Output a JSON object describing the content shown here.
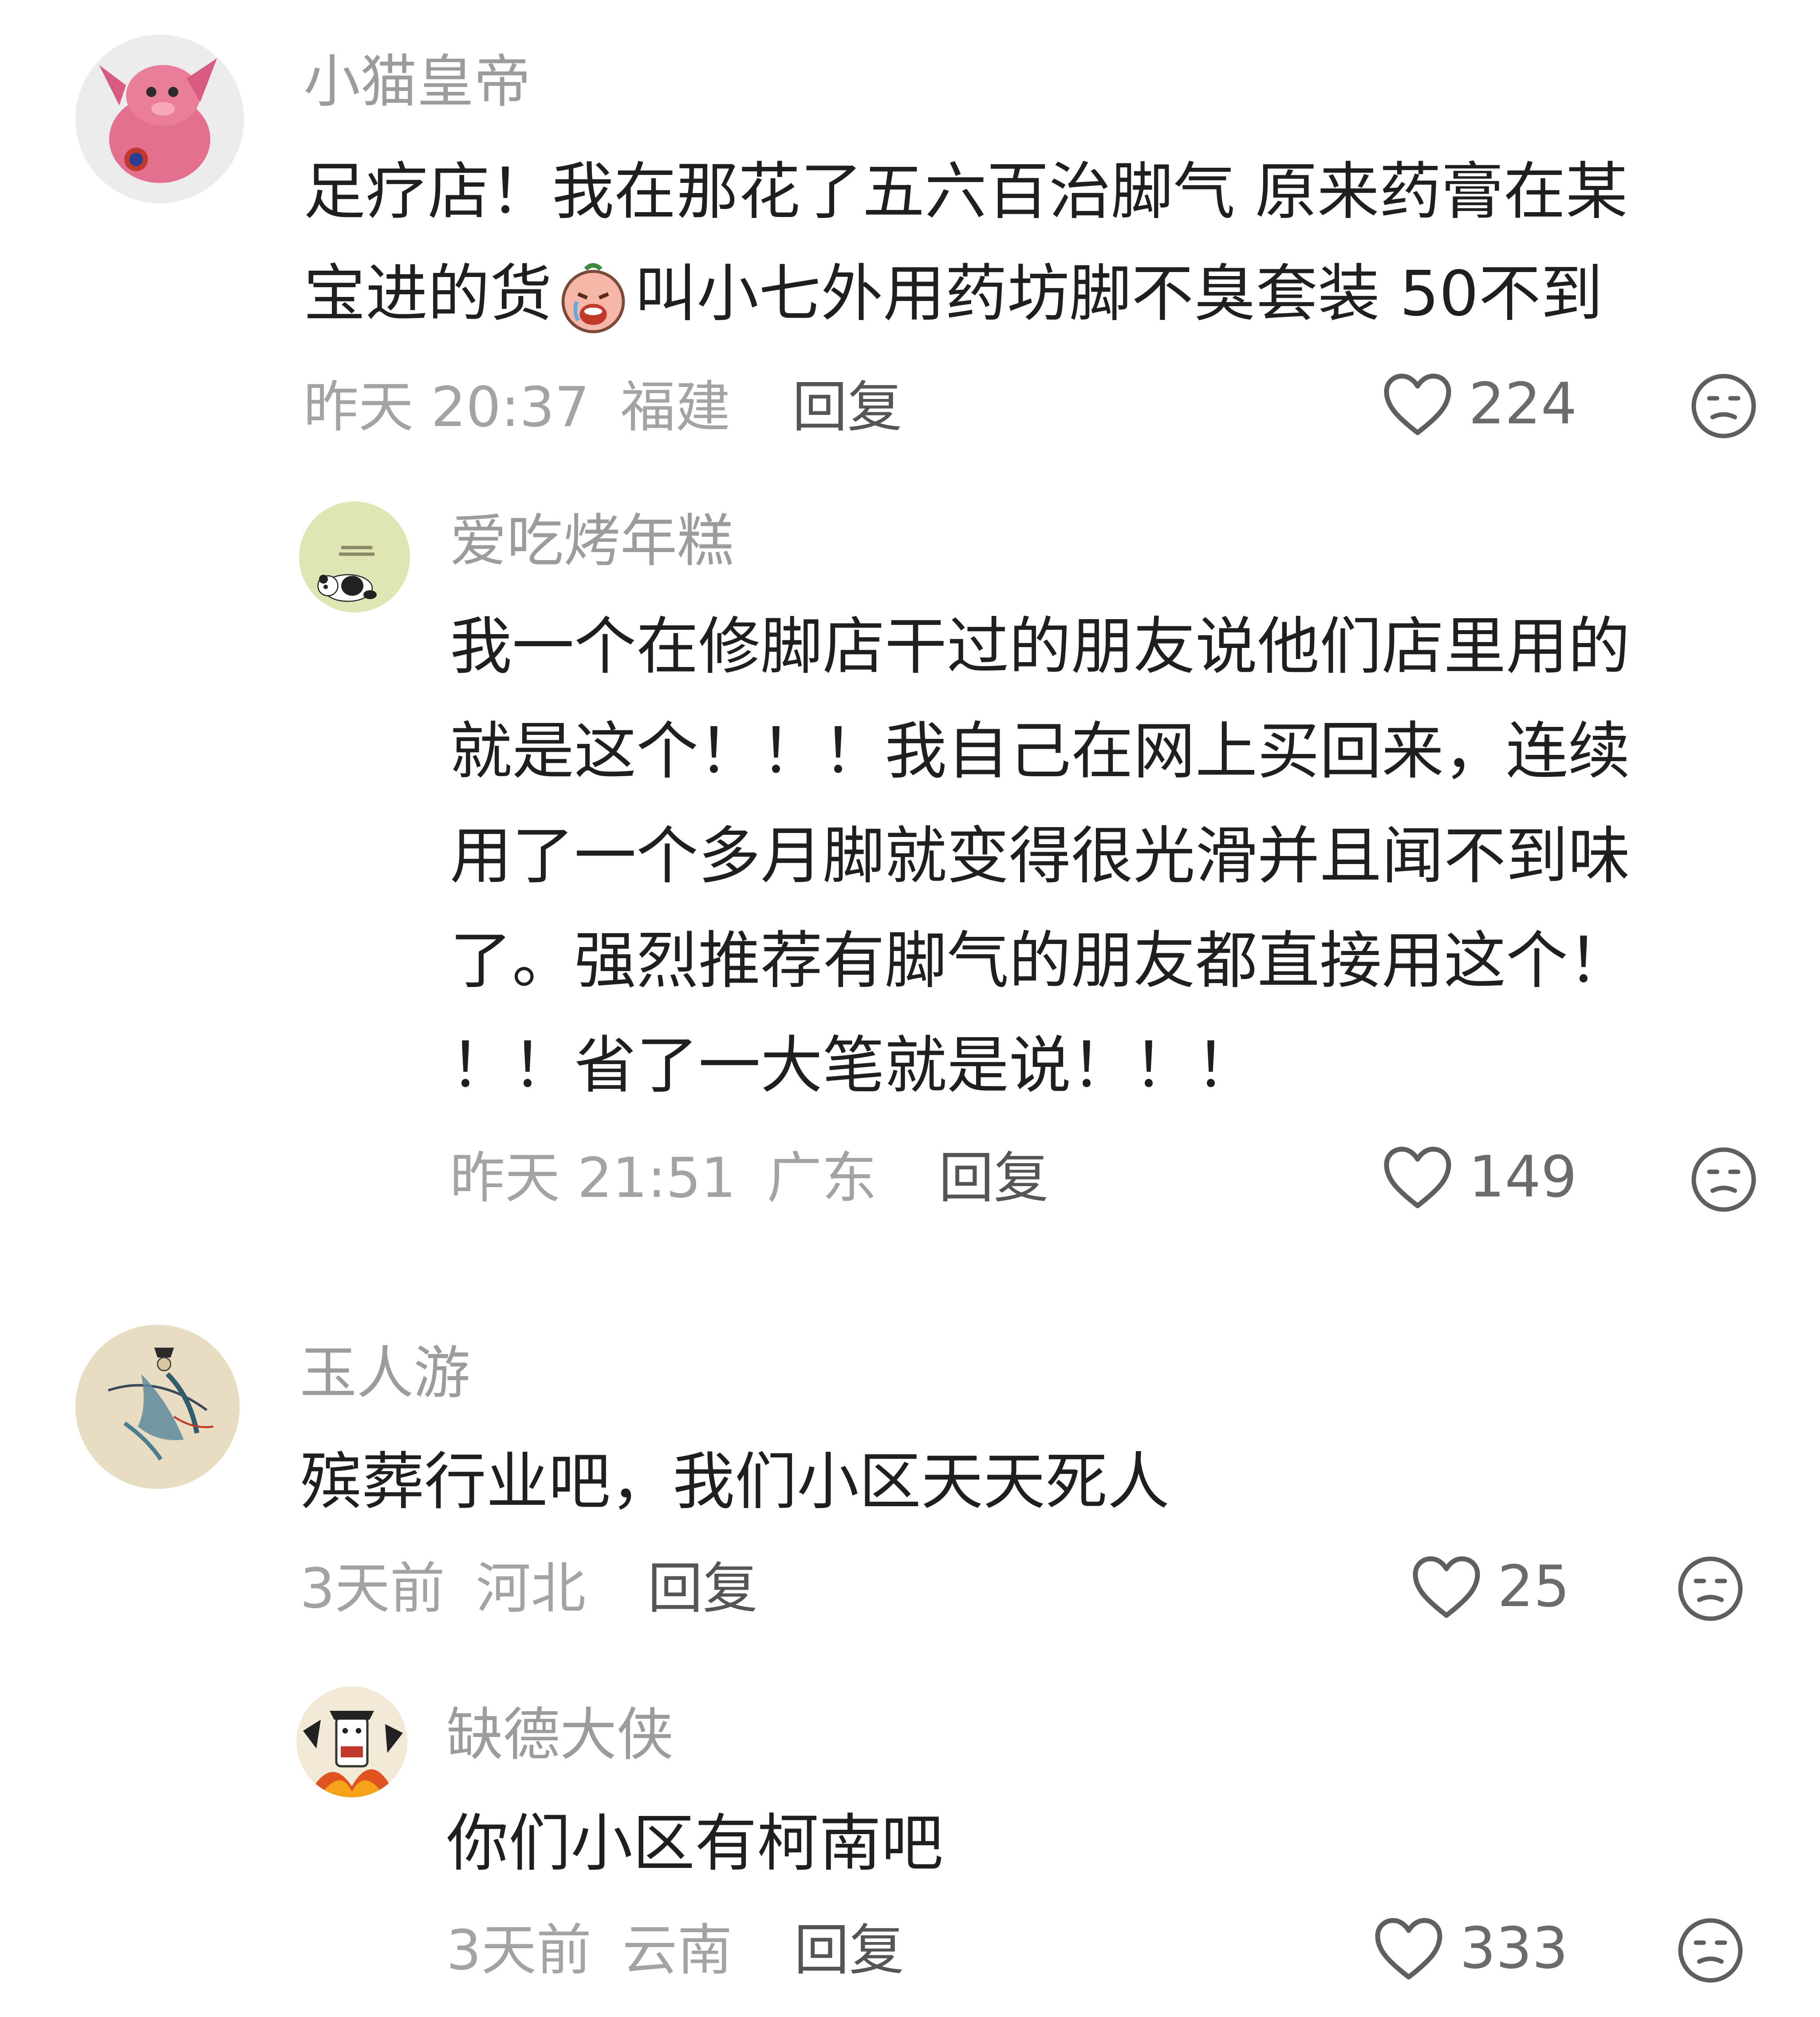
{
  "comments": [
    {
      "username": "小猫皇帝",
      "content_lines": [
        "足疗店！我在那花了五六百治脚气 原来药膏在某",
        "宝进的货",
        "叫小七外用药坊脚不臭套装 50不到"
      ],
      "time": "昨天 20:37",
      "location": "福建",
      "reply_label": "回复",
      "likes": "224",
      "avatar": "pink-plush-avatar"
    },
    {
      "username": "爱吃烤年糕",
      "content_lines": [
        "我一个在修脚店干过的朋友说他们店里用的",
        "就是这个！！！我自己在网上买回来，连续",
        "用了一个多月脚就变得很光滑并且闻不到味",
        "了。强烈推荐有脚气的朋友都直接用这个！",
        "！！省了一大笔就是说！！！"
      ],
      "time": "昨天 21:51",
      "location": "广东",
      "reply_label": "回复",
      "likes": "149",
      "avatar": "panda-avatar"
    },
    {
      "username": "玉人游",
      "content_lines": [
        "殡葬行业吧，我们小区天天死人"
      ],
      "time": "3天前",
      "location": "河北",
      "reply_label": "回复",
      "likes": "25",
      "avatar": "ink-painting-avatar"
    },
    {
      "username": "缺德大侠",
      "content_lines": [
        "你们小区有柯南吧"
      ],
      "time": "3天前",
      "location": "云南",
      "reply_label": "回复",
      "likes": "333",
      "avatar": "que-de-avatar"
    }
  ],
  "icons": {
    "like": "heart-outline-icon",
    "dislike": "meh-face-icon",
    "inline_emoji": "crying-face-emoji"
  },
  "colors": {
    "username": "#9c9c9c",
    "meta": "#a3a3a3",
    "text": "#1f1f1f"
  }
}
